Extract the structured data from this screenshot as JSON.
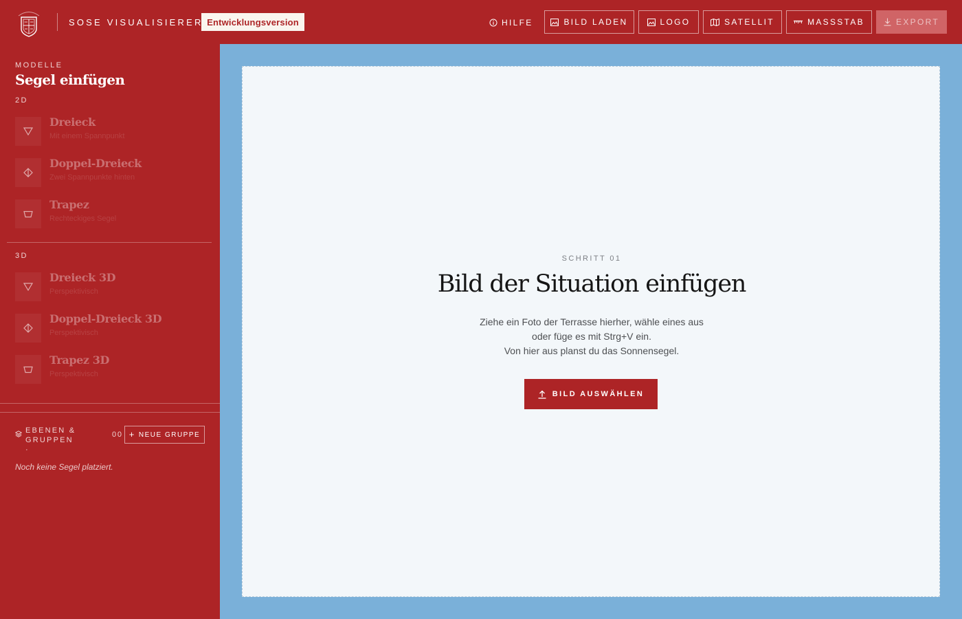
{
  "header": {
    "app_title": "SOSE VISUALISIERER",
    "badge": "Entwicklungsversion",
    "help_label": "HILFE",
    "buttons": {
      "load_image": "BILD LADEN",
      "logo": "LOGO",
      "satellite": "SATELLIT",
      "scale": "MASSSTAB",
      "export": "EXPORT"
    }
  },
  "sidebar": {
    "section_label": "MODELLE",
    "heading": "Segel einfügen",
    "groups": [
      {
        "label": "2D",
        "items": [
          {
            "name": "Dreieck",
            "sub": "Mit einem Spannpunkt",
            "icon": "triangle-icon"
          },
          {
            "name": "Doppel-Dreieck",
            "sub": "Zwei Spannpunkte hinten",
            "icon": "double-triangle-icon"
          },
          {
            "name": "Trapez",
            "sub": "Rechteckiges Segel",
            "icon": "trapezoid-icon"
          }
        ]
      },
      {
        "label": "3D",
        "items": [
          {
            "name": "Dreieck 3D",
            "sub": "Perspektivisch",
            "icon": "triangle-icon"
          },
          {
            "name": "Doppel-Dreieck 3D",
            "sub": "Perspektivisch",
            "icon": "double-triangle-icon"
          },
          {
            "name": "Trapez 3D",
            "sub": "Perspektivisch",
            "icon": "trapezoid-icon"
          }
        ]
      }
    ],
    "layers": {
      "label_line1": "EBENEN &",
      "label_line2": "GRUPPEN ·",
      "count": "00",
      "new_group_label": "NEUE GRUPPE",
      "empty_text": "Noch keine Segel platziert."
    }
  },
  "canvas": {
    "step_label": "SCHRITT 01",
    "title": "Bild der Situation einfügen",
    "description_lines": [
      "Ziehe ein Foto der Terrasse hierher, wähle eines aus",
      "oder füge es mit Strg+V ein.",
      "Von hier aus planst du das Sonnensegel."
    ],
    "button_label": "BILD AUSWÄHLEN"
  },
  "colors": {
    "brand_red": "#ad2426",
    "canvas_blue": "#7ab0d9",
    "dropzone_bg": "#f3f7fa",
    "badge_bg": "#faf5ef"
  }
}
